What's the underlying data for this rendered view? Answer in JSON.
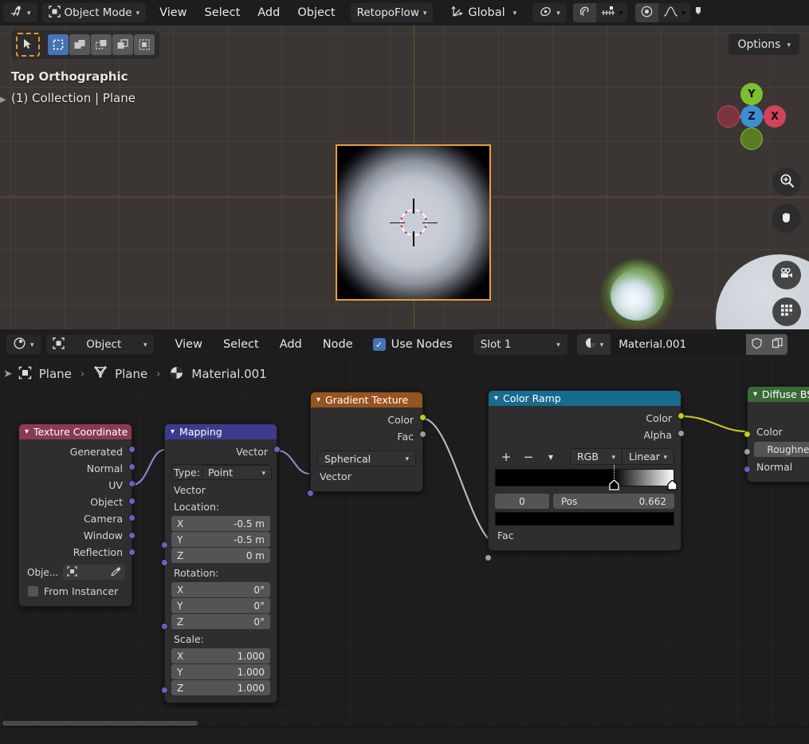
{
  "topbar": {
    "editor_type_icon": "editor-type-icon",
    "mode": "Object Mode",
    "menus": [
      "View",
      "Select",
      "Add",
      "Object"
    ],
    "workspace": "RetopoFlow",
    "transform_orientation": "Global",
    "pivot_icon": "pivot-point-icon",
    "snap_icon": "snap-magnet-icon",
    "snap_target_icon": "snap-increment-icon",
    "proportional_icon": "proportional-edit-icon",
    "falloff_icon": "falloff-curve-icon",
    "overflow_icon": "overflow-icon"
  },
  "viewport": {
    "tools": {
      "cursor_icon": "tweak-cursor-icon",
      "select_modes": [
        "select-box-new-icon",
        "select-box-extend-icon",
        "select-box-subtract-icon",
        "select-box-invert-icon",
        "select-box-intersect-icon"
      ],
      "active_index": 0
    },
    "view_name": "Top Orthographic",
    "scene_info": "(1) Collection | Plane",
    "options_label": "Options",
    "gizmo": {
      "axes": [
        "X",
        "Y",
        "Z"
      ],
      "colors": {
        "x": "#d0445a",
        "y": "#7dbf2e",
        "z": "#3b8fd4",
        "x_neg": "#7d3340",
        "y_neg": "#5a7a24"
      }
    },
    "nav_icons": [
      "zoom-icon",
      "pan-hand-icon",
      "camera-view-icon",
      "toggle-perspective-grid-icon"
    ],
    "objects": [
      "textured-plane",
      "hdri-preview-sphere",
      "grey-sphere"
    ],
    "selection_outline_color": "#ed9e32"
  },
  "node_editor_header": {
    "editor_type_icon": "shader-editor-icon",
    "shader_type": "Object",
    "menus": [
      "View",
      "Select",
      "Add",
      "Node"
    ],
    "use_nodes_label": "Use Nodes",
    "use_nodes_checked": true,
    "slot": "Slot 1",
    "material_browse_icon": "material-browse-icon",
    "material_name": "Material.001",
    "fake_user_icon": "shield-fake-user-icon",
    "new_material_icon": "duplicate-material-icon"
  },
  "breadcrumb": {
    "items": [
      {
        "label": "Plane",
        "icon": "object-icon"
      },
      {
        "label": "Plane",
        "icon": "mesh-data-icon"
      },
      {
        "label": "Material.001",
        "icon": "material-icon"
      }
    ],
    "separator": "›"
  },
  "nodes": [
    {
      "id": "texture-coordinate",
      "title": "Texture Coordinate",
      "header_color": "#893b53",
      "outputs": [
        "Generated",
        "Normal",
        "UV",
        "Object",
        "Camera",
        "Window",
        "Reflection"
      ],
      "object_field_label": "Obje...",
      "object_field_value": "",
      "eyedropper_icon": "eyedropper-icon",
      "from_instancer_label": "From Instancer",
      "from_instancer_checked": false,
      "socket_color": "#6363c7"
    },
    {
      "id": "mapping",
      "title": "Mapping",
      "header_color": "#3c3c8f",
      "outputs": [
        "Vector"
      ],
      "type_label": "Type:",
      "type_value": "Point",
      "input_vector": "Vector",
      "location_label": "Location:",
      "location": {
        "X": "-0.5 m",
        "Y": "-0.5 m",
        "Z": "0 m"
      },
      "rotation_label": "Rotation:",
      "rotation": {
        "X": "0°",
        "Y": "0°",
        "Z": "0°"
      },
      "scale_label": "Scale:",
      "scale": {
        "X": "1.000",
        "Y": "1.000",
        "Z": "1.000"
      },
      "socket_color": "#6363c7"
    },
    {
      "id": "gradient-texture",
      "title": "Gradient Texture",
      "header_color": "#96541f",
      "outputs": [
        "Color",
        "Fac"
      ],
      "gradient_type": "Spherical",
      "input_vector": "Vector",
      "color_socket": "#c7c729",
      "fac_socket": "#9d9d9d",
      "vector_socket": "#6363c7"
    },
    {
      "id": "color-ramp",
      "title": "Color Ramp",
      "header_color": "#186a8f",
      "outputs": [
        "Color",
        "Alpha"
      ],
      "add_label": "+",
      "remove_label": "−",
      "menu_label": "⌄",
      "interpolation_mode": "RGB",
      "interpolation_type": "Linear",
      "index_value": "0",
      "pos_label": "Pos",
      "pos_value": "0.662",
      "stops": [
        {
          "pos": 0.662,
          "color": "#000000"
        },
        {
          "pos": 1.0,
          "color": "#ffffff"
        }
      ],
      "selected_color": "#000000",
      "input_fac": "Fac",
      "color_socket": "#c7c729",
      "alpha_socket": "#9d9d9d",
      "fac_socket": "#9d9d9d"
    },
    {
      "id": "diffuse-bsdf",
      "title": "Diffuse BSD",
      "header_color": "#396a36",
      "inputs": [
        "Color",
        "Roughnes",
        "Normal"
      ],
      "color_socket": "#c7c729",
      "roughness_socket": "#9d9d9d",
      "normal_socket": "#6363c7"
    }
  ],
  "wires": [
    {
      "from": "texture-coordinate.UV",
      "to": "mapping.Vector",
      "color": "#8a8ad0"
    },
    {
      "from": "mapping.Vector",
      "to": "gradient-texture.Vector",
      "color": "#8a8ad0"
    },
    {
      "from": "gradient-texture.Color",
      "to": "color-ramp.Fac",
      "color": "#bdbdbd"
    },
    {
      "from": "color-ramp.Color",
      "to": "diffuse-bsdf.Color",
      "color": "#c7c729"
    }
  ]
}
